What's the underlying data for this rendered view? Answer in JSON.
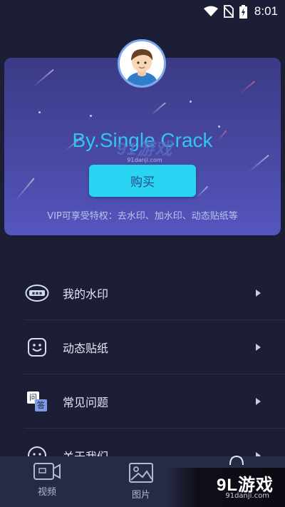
{
  "status_bar": {
    "time": "8:01"
  },
  "vip_card": {
    "name": "By.Single Crack",
    "buy_button": "购买",
    "description": "VIP可享受特权：去水印、加水印、动态贴纸等"
  },
  "menu": {
    "items": [
      {
        "label": "我的水印",
        "icon": "watermark-icon"
      },
      {
        "label": "动态贴纸",
        "icon": "smiley-sticker-icon"
      },
      {
        "label": "常见问题",
        "icon": "qa-icon",
        "icon_q": "问",
        "icon_a": "答"
      },
      {
        "label": "关于我们",
        "icon": "info-face-icon"
      }
    ]
  },
  "bottom_nav": {
    "tabs": [
      {
        "label": "视频",
        "icon": "video-camera-icon"
      },
      {
        "label": "图片",
        "icon": "image-icon"
      }
    ]
  },
  "watermarks": {
    "center_main": "91游戏",
    "center_sub": "91danji.com",
    "corner_main": "9L游戏",
    "corner_sub": "91danji.com"
  },
  "colors": {
    "background": "#1c1e35",
    "card": "#4a4aa6",
    "name_text": "#33c4f2",
    "buy_button": "#29d5f3",
    "bottom_nav": "#272a44"
  }
}
